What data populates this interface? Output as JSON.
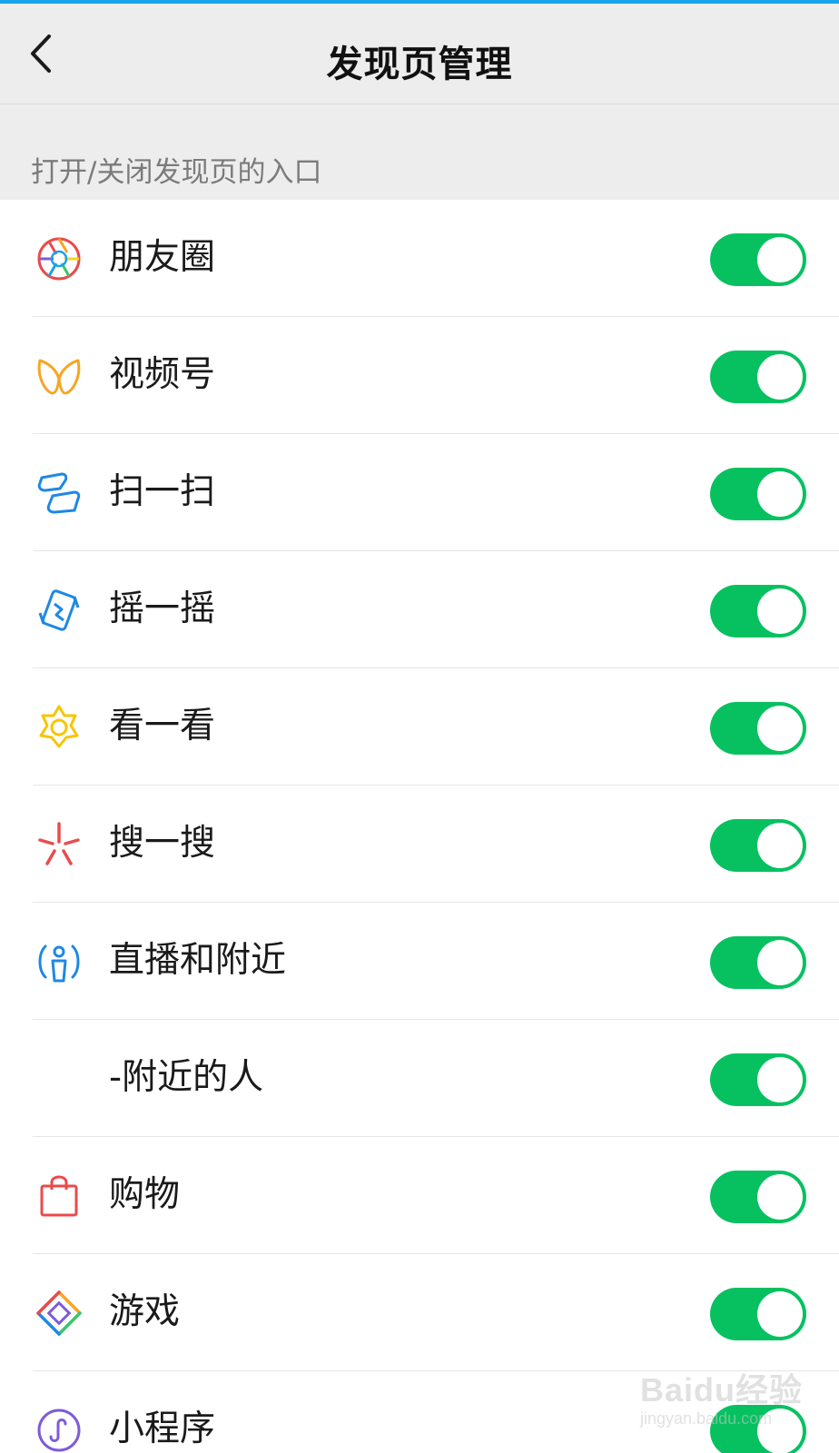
{
  "header": {
    "title": "发现页管理",
    "back_icon": "chevron-left-icon"
  },
  "section": {
    "caption": "打开/关闭发现页的入口"
  },
  "items": [
    {
      "label": "朋友圈",
      "icon": "moments-aperture-icon",
      "enabled": true
    },
    {
      "label": "视频号",
      "icon": "channels-butterfly-icon",
      "enabled": true
    },
    {
      "label": "扫一扫",
      "icon": "scan-icon",
      "enabled": true
    },
    {
      "label": "摇一摇",
      "icon": "shake-icon",
      "enabled": true
    },
    {
      "label": "看一看",
      "icon": "top-stories-star-icon",
      "enabled": true
    },
    {
      "label": "搜一搜",
      "icon": "search-sparkle-icon",
      "enabled": true
    },
    {
      "label": "直播和附近",
      "icon": "live-nearby-icon",
      "enabled": true
    },
    {
      "label": "-附近的人",
      "icon": "",
      "enabled": true
    },
    {
      "label": "购物",
      "icon": "shopping-bag-icon",
      "enabled": true
    },
    {
      "label": "游戏",
      "icon": "games-diamond-icon",
      "enabled": true
    },
    {
      "label": "小程序",
      "icon": "mini-programs-icon",
      "enabled": true
    }
  ],
  "watermark": {
    "main": "Baidu经验",
    "sub": "jingyan.baidu.com"
  },
  "colors": {
    "toggle_on": "#07c160",
    "background": "#ededed",
    "accent_bar": "#1aa3e8"
  }
}
